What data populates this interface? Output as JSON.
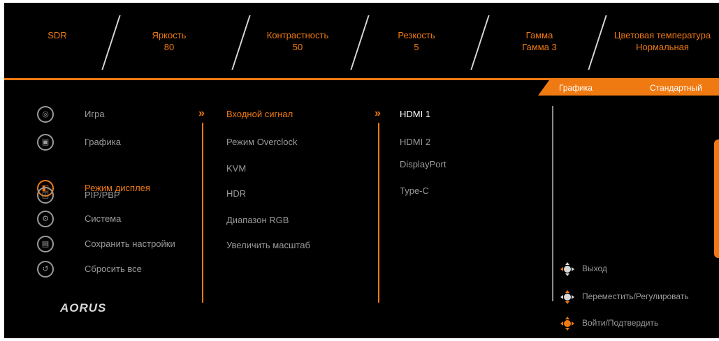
{
  "top_bar": [
    {
      "label": "SDR",
      "value": ""
    },
    {
      "label": "Яркость",
      "value": "80"
    },
    {
      "label": "Контрастность",
      "value": "50"
    },
    {
      "label": "Резкость",
      "value": "5"
    },
    {
      "label": "Гамма",
      "value": "Гамма 3"
    },
    {
      "label": "Цветовая температура",
      "value": "Нормальная"
    }
  ],
  "mode_tab": {
    "name": "Графика",
    "value": "Стандартный"
  },
  "main_menu": [
    {
      "label": "Игра",
      "icon": "gamepad-icon"
    },
    {
      "label": "Графика",
      "icon": "picture-icon"
    },
    {
      "label": "Режим дисплея",
      "icon": "display-mode-icon",
      "active": true
    },
    {
      "label": "PIP/PBP",
      "icon": "pip-icon"
    },
    {
      "label": "Система",
      "icon": "gear-icon"
    },
    {
      "label": "Сохранить настройки",
      "icon": "save-icon"
    },
    {
      "label": "Сбросить все",
      "icon": "reset-icon"
    }
  ],
  "submenu": [
    {
      "label": "Входной сигнал",
      "active": true
    },
    {
      "label": "Режим Overclock"
    },
    {
      "label": "KVM"
    },
    {
      "label": "HDR"
    },
    {
      "label": "Диапазон RGB"
    },
    {
      "label": "Увеличить масштаб"
    }
  ],
  "options": [
    {
      "label": "HDMI 1",
      "active": true
    },
    {
      "label": "HDMI 2"
    },
    {
      "label": "DisplayPort"
    },
    {
      "label": "Type-C"
    }
  ],
  "hints": [
    {
      "label": "Выход",
      "icon": "joystick-left-icon"
    },
    {
      "label": "Переместить/Регулировать",
      "icon": "joystick-updown-icon"
    },
    {
      "label": "Войти/Подтвердить",
      "icon": "joystick-press-icon"
    }
  ],
  "logo": "AORUS",
  "colors": {
    "accent": "#f07a12",
    "background": "#000000",
    "text_inactive": "#9a9a9a",
    "text_active": "#ffffff"
  }
}
